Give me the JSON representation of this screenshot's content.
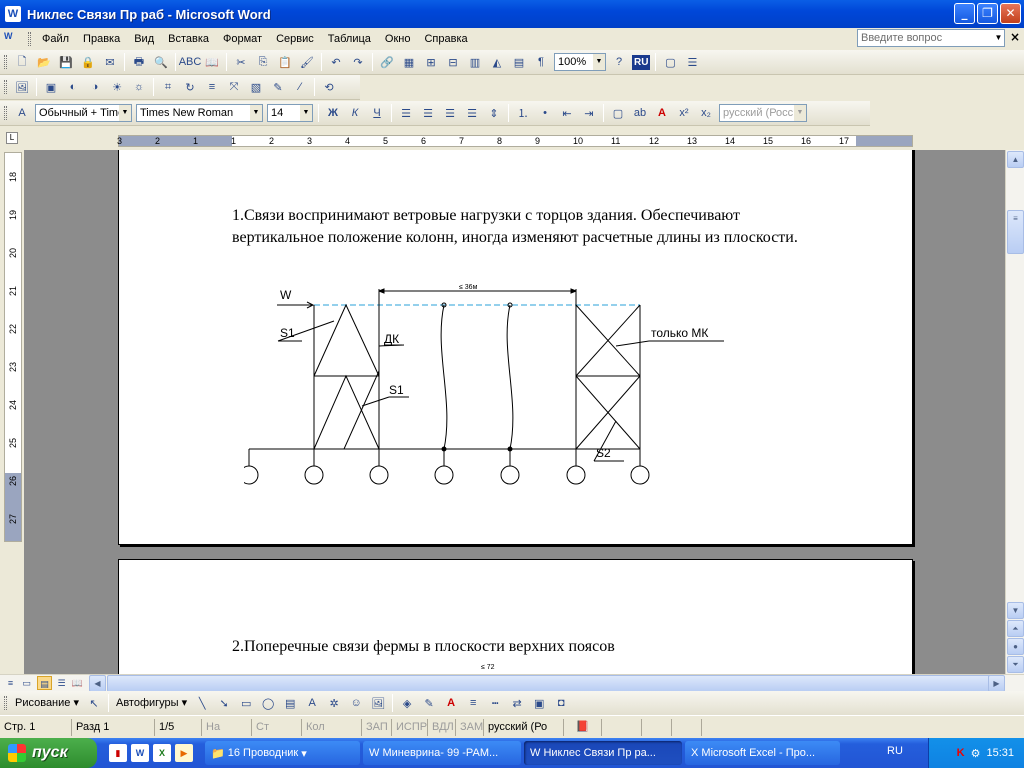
{
  "window": {
    "title": "Никлес Связи Пр раб - Microsoft Word",
    "icon": "word-icon"
  },
  "menu": {
    "items": [
      "Файл",
      "Правка",
      "Вид",
      "Вставка",
      "Формат",
      "Сервис",
      "Таблица",
      "Окно",
      "Справка"
    ],
    "ask_placeholder": "Введите вопрос"
  },
  "standard_toolbar": {
    "zoom": "100%",
    "lang_badge": "RU"
  },
  "formatting_toolbar": {
    "style": "Обычный + Time",
    "font": "Times New Roman",
    "size": "14",
    "lang": "русский (Росс"
  },
  "ruler": {
    "labels": [
      "3",
      "2",
      "1",
      "1",
      "2",
      "3",
      "4",
      "5",
      "6",
      "7",
      "8",
      "9",
      "10",
      "11",
      "12",
      "13",
      "14",
      "15",
      "16",
      "17"
    ]
  },
  "vruler": {
    "labels": [
      "18",
      "19",
      "20",
      "21",
      "22",
      "23",
      "24",
      "25",
      "26",
      "27"
    ]
  },
  "document": {
    "para1": "1.Связи воспринимают ветровые нагрузки с торцов здания. Обеспечивают вертикальное положение колонн, иногда изменяют расчетные длины из плоскости.",
    "para2": "2.Поперечные связи фермы в плоскости верхних поясов",
    "figure": {
      "wind_label": "W",
      "s1_top": "S1",
      "dk": "ДК",
      "s1_mid": "S1",
      "span": "≤ 36м",
      "mk": "только  МК",
      "s2": "S2",
      "bottom_dim": "≤ 72"
    }
  },
  "drawing_toolbar": {
    "draw_label": "Рисование",
    "autoshapes": "Автофигуры"
  },
  "statusbar": {
    "page": "Стр.  1",
    "section": "Разд  1",
    "pages": "1/5",
    "at": "На",
    "line": "Ст",
    "col": "Кол",
    "rec": "ЗАП",
    "trk": "ИСПР",
    "ext": "ВДЛ",
    "ovr": "ЗАМ",
    "lang": "русский (Ро"
  },
  "taskbar": {
    "start": "пуск",
    "tasks": [
      {
        "label": "16 Проводник",
        "active": false
      },
      {
        "label": "Миневрина- 99 -РАМ...",
        "active": false
      },
      {
        "label": "Никлес Связи Пр ра...",
        "active": true
      },
      {
        "label": "Microsoft Excel - Про...",
        "active": false
      }
    ],
    "lang": "RU",
    "clock": "15:31"
  }
}
